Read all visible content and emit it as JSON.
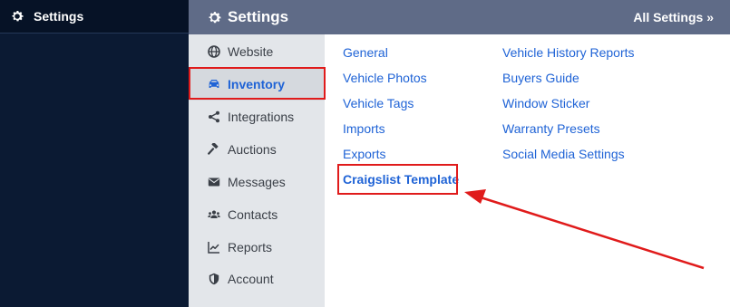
{
  "sidebar": {
    "title": "Settings"
  },
  "header": {
    "title": "Settings",
    "all_settings_link": "All Settings »"
  },
  "subnav": {
    "items": [
      {
        "label": "Website",
        "icon": "globe-icon"
      },
      {
        "label": "Inventory",
        "icon": "car-icon",
        "active": true
      },
      {
        "label": "Integrations",
        "icon": "share-icon"
      },
      {
        "label": "Auctions",
        "icon": "gavel-icon"
      },
      {
        "label": "Messages",
        "icon": "envelope-icon"
      },
      {
        "label": "Contacts",
        "icon": "users-icon"
      },
      {
        "label": "Reports",
        "icon": "chart-line-icon"
      },
      {
        "label": "Account",
        "icon": "shield-icon"
      }
    ]
  },
  "inventory_links": {
    "col1": [
      "General",
      "Vehicle Photos",
      "Vehicle Tags",
      "Imports",
      "Exports",
      "Craigslist Template"
    ],
    "col2": [
      "Vehicle History Reports",
      "Buyers Guide",
      "Window Sticker",
      "Warranty Presets",
      "Social Media Settings"
    ]
  },
  "colors": {
    "accent": "#1f63d6",
    "annotation": "#e01b1b",
    "sidebar_bg": "#0b1a33",
    "topbar_bg": "#5f6b87",
    "subnav_bg": "#e3e6ea"
  }
}
